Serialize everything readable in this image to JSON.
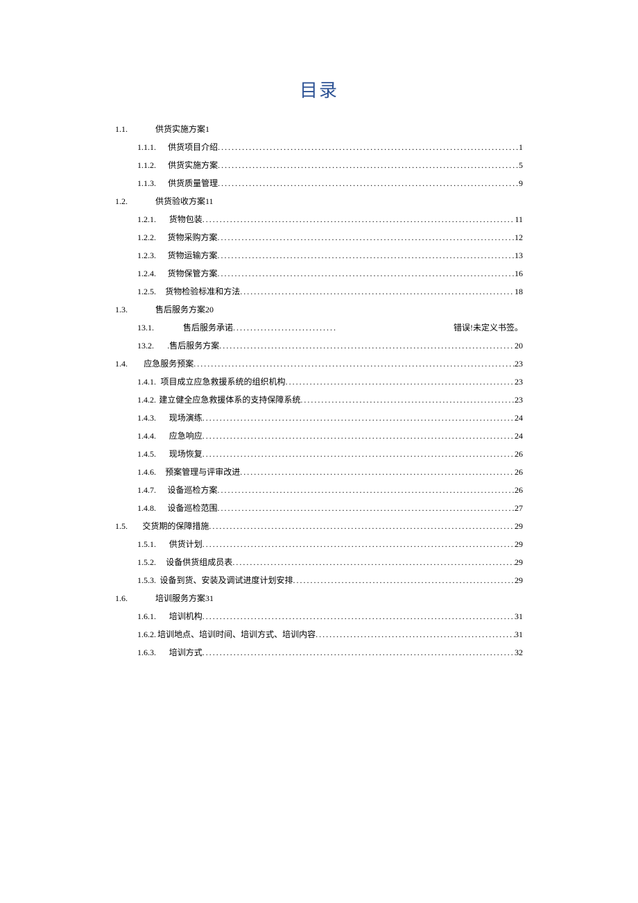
{
  "title": "目录",
  "error_text": "错误!未定义书签。",
  "entries": [
    {
      "level": 1,
      "num": "1.1.",
      "label": "供货实施方案1",
      "page": "",
      "style": "nodots"
    },
    {
      "level": 2,
      "num": "1.1.1.",
      "label": "供货项目介绍",
      "page": "1",
      "style": "dots"
    },
    {
      "level": 2,
      "num": "1.1.2.",
      "label": "供货实施方案",
      "page": "5",
      "style": "dots"
    },
    {
      "level": 2,
      "num": "1.1.3.",
      "label": "供货质量管理",
      "page": "9",
      "style": "dots"
    },
    {
      "level": 1,
      "num": "1.2.",
      "label": "供货验收方案11",
      "page": "",
      "style": "nodots"
    },
    {
      "level": 2,
      "num": "1.2.1.",
      "label": "货物包装",
      "page": "11",
      "style": "dots"
    },
    {
      "level": 2,
      "num": "1.2.2.",
      "label": "货物采购方案",
      "page": "12",
      "style": "dots"
    },
    {
      "level": 2,
      "num": "1.2.3.",
      "label": "货物运输方案",
      "page": "13",
      "style": "dots"
    },
    {
      "level": 2,
      "num": "1.2.4.",
      "label": "货物保管方案",
      "page": "16",
      "style": "dots"
    },
    {
      "level": 2,
      "num": "1.2.5.",
      "label": "货物检验标准和方法",
      "page": "18",
      "style": "dots"
    },
    {
      "level": 1,
      "num": "1.3.",
      "label": "售后服务方案20",
      "page": "",
      "style": "nodots"
    },
    {
      "level": 2,
      "num": "13.1.",
      "label": "售后服务承诺",
      "page": "",
      "style": "error"
    },
    {
      "level": 2,
      "num": "13.2.",
      "label": ".售后服务方案",
      "page": "20",
      "style": "dots"
    },
    {
      "level": 1,
      "num": "1.4.",
      "label": "应急服务预案",
      "page": "23",
      "style": "dots"
    },
    {
      "level": 2,
      "num": "1.4.1.",
      "label": "项目成立应急救援系统的组织机构",
      "page": "23",
      "style": "dots"
    },
    {
      "level": 2,
      "num": "1.4.2.",
      "label": "建立健全应急救援体系的支持保障系统",
      "page": "23",
      "style": "dots"
    },
    {
      "level": 2,
      "num": "1.4.3.",
      "label": "现场演练",
      "page": "24",
      "style": "dots"
    },
    {
      "level": 2,
      "num": "1.4.4.",
      "label": "应急响应",
      "page": "24",
      "style": "dots"
    },
    {
      "level": 2,
      "num": "1.4.5.",
      "label": "现场恢复",
      "page": "26",
      "style": "dots"
    },
    {
      "level": 2,
      "num": "1.4.6.",
      "label": "预案管理与评审改进",
      "page": "26",
      "style": "dots"
    },
    {
      "level": 2,
      "num": "1.4.7.",
      "label": "设备巡检方案",
      "page": "26",
      "style": "dots"
    },
    {
      "level": 2,
      "num": "1.4.8.",
      "label": "设备巡检范围",
      "page": "27",
      "style": "dots"
    },
    {
      "level": 1,
      "num": "1.5.",
      "label": "交货期的保障措施",
      "page": "29",
      "style": "dots"
    },
    {
      "level": 2,
      "num": "1.5.1.",
      "label": "供货计划",
      "page": "29",
      "style": "dots"
    },
    {
      "level": 2,
      "num": "1.5.2.",
      "label": "设备供货组成员表",
      "page": "29",
      "style": "dots"
    },
    {
      "level": 2,
      "num": "1.5.3.",
      "label": "设备到货、安装及调试进度计划安排",
      "page": "29",
      "style": "dots"
    },
    {
      "level": 1,
      "num": "1.6.",
      "label": "培训服务方案31",
      "page": "",
      "style": "nodots"
    },
    {
      "level": 2,
      "num": "1.6.1.",
      "label": "培训机构",
      "page": "31",
      "style": "dots"
    },
    {
      "level": 2,
      "num": "1.6.2.",
      "label": "培训地点、培训时间、培训方式、培训内容",
      "page": "31",
      "style": "dots"
    },
    {
      "level": 2,
      "num": "1.6.3.",
      "label": "培训方式",
      "page": "32",
      "style": "dots"
    }
  ]
}
